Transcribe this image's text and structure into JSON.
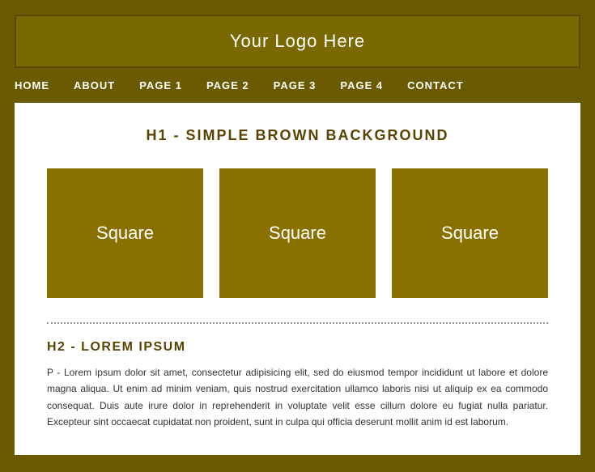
{
  "header": {
    "logo_text": "Your Logo Here"
  },
  "nav": {
    "items": [
      {
        "label": "HOME",
        "id": "home"
      },
      {
        "label": "ABOUT",
        "id": "about"
      },
      {
        "label": "PAGE 1",
        "id": "page1"
      },
      {
        "label": "PAGE 2",
        "id": "page2"
      },
      {
        "label": "PAGE 3",
        "id": "page3"
      },
      {
        "label": "PAGE 4",
        "id": "page4"
      },
      {
        "label": "CONTACT",
        "id": "contact"
      }
    ]
  },
  "main": {
    "h1": "H1 - Simple Brown Background",
    "squares": [
      {
        "label": "Square"
      },
      {
        "label": "Square"
      },
      {
        "label": "Square"
      }
    ],
    "h2": "H2 - Lorem Ipsum",
    "paragraph": "P - Lorem ipsum dolor sit amet, consectetur adipisicing elit, sed do eiusmod tempor incididunt ut labore et dolore magna aliqua. Ut enim ad minim veniam, quis nostrud exercitation ullamco laboris nisi ut aliquip ex ea commodo consequat. Duis aute irure dolor in reprehenderit in voluptate velit esse cillum dolore eu fugiat nulla pariatur. Excepteur sint occaecat cupidatat non proident, sunt in culpa qui officia deserunt mollit anim id est laborum."
  }
}
